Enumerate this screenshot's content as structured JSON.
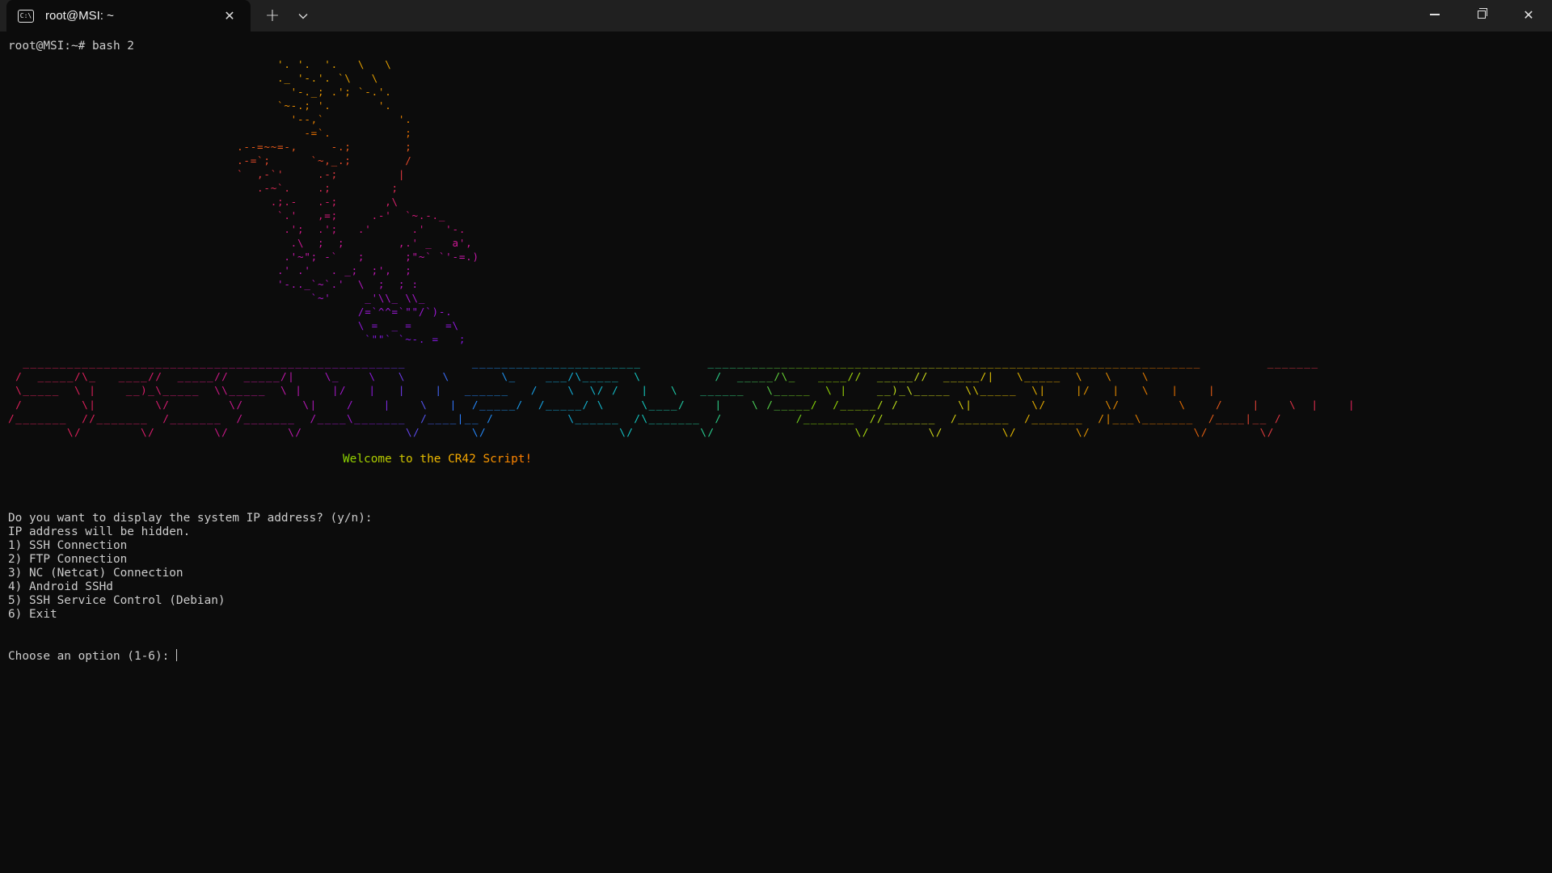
{
  "window": {
    "tab_title": "root@MSI: ~",
    "tab_icon_text": "C:\\",
    "close_tab_glyph": "✕",
    "new_tab_glyph": "+",
    "dropdown_glyph": "⌄",
    "close_window_glyph": "✕"
  },
  "terminal": {
    "command_line": "root@MSI:~# bash 2",
    "art_lines": [
      {
        "text": "                                        '. '.  '.   \\   \\",
        "color": "#e6a100"
      },
      {
        "text": "                                        ._ '-.'. `\\   \\",
        "color": "#e6a100"
      },
      {
        "text": "                                          '-._; .'; `-.'.",
        "color": "#e69400"
      },
      {
        "text": "                                        `~-.; '.       '.",
        "color": "#e68a00"
      },
      {
        "text": "                                          '--,`           '.",
        "color": "#e68000"
      },
      {
        "text": "                                            -=`.           ;",
        "color": "#e66f00"
      },
      {
        "text": "                                  .--=~~=-,     -.;        ;",
        "color": "#e65a1a"
      },
      {
        "text": "                                  .-=`;      `~,_.;        /",
        "color": "#e64a2a"
      },
      {
        "text": "                                  `  ,-`'     .-;         |",
        "color": "#e03a40"
      },
      {
        "text": "                                     .-~`.    .;         ;",
        "color": "#dc2b55"
      },
      {
        "text": "                                       .;.-   .-;       ,\\",
        "color": "#d8206a"
      },
      {
        "text": "                                        `.'   ,=;     .-'  `~.-._",
        "color": "#d41a7a"
      },
      {
        "text": "                                         .';  .';   .'      .'   '-.",
        "color": "#d01888"
      },
      {
        "text": "                                          .\\  ;  ;        ,.' _   a',",
        "color": "#cc1895"
      },
      {
        "text": "                                         .'~\"; -`   ;      ;\"~` `'-=.)",
        "color": "#c418a8"
      },
      {
        "text": "                                        .' .'   . _;  ;',  ;",
        "color": "#be18b4"
      },
      {
        "text": "                                        '-.._`~`.'  \\  ;  ; :",
        "color": "#b418c0"
      },
      {
        "text": "                                             `~'     _'\\\\_ \\\\_",
        "color": "#a818cc"
      },
      {
        "text": "                                                    /=`^^=`\"\"/`)-.",
        "color": "#9c18d6"
      },
      {
        "text": "                                                    \\ =  _ =     =\\",
        "color": "#9018dc"
      },
      {
        "text": "                                                     `\"\"` `~-. =   ;",
        "color": "#8418e0"
      }
    ],
    "banner_lines": [
      {
        "text": "  ____________________________________________________         _______________________         ___________________________________________________________________         _______",
        "colors": [
          "#e0205c",
          "#2a7fff",
          "#c8e020"
        ]
      },
      {
        "text": " /  _____/\\_   ____//  _____//  _____/|    \\_    \\   \\     \\       \\_    ___/\\_____  \\          /  _____/\\_   ____//  _____//  _____/|   \\_____  \\   \\    \\",
        "colors": []
      },
      {
        "text": " \\_____  \\ |    __)_\\_____  \\\\_____  \\ |    |/   |   |    |   ______   /    \\  \\/ /   |   \\   ______   \\_____  \\ |    __)_\\_____  \\\\_____  \\|    |/   |   \\   |    |",
        "colors": []
      },
      {
        "text": " /        \\|        \\/        \\/        \\|    /    |    \\   |  /_____/  /_____/ \\     \\____/    |    \\ /_____/  /_____/ /        \\|        \\/        \\/        \\    /    |    \\  |    |",
        "colors": []
      },
      {
        "text": "/_______  //_______  /_______  /_______  /____\\_______  /____|__ /          \\______  /\\_______  /          /_______  //_______  /_______  /_______  /|___\\_______  /____|__ /",
        "colors": []
      },
      {
        "text": "        \\/        \\/        \\/        \\/              \\/       \\/                  \\/         \\/                   \\/        \\/        \\/        \\/              \\/       \\/",
        "colors": []
      }
    ],
    "welcome_text": "Welcome to the CR42 Script!",
    "welcome_colors": [
      "#8cd400",
      "#f2b900",
      "#ff7a00"
    ],
    "output_lines": [
      "Do you want to display the system IP address? (y/n):",
      "IP address will be hidden.",
      "1) SSH Connection",
      "2) FTP Connection",
      "3) NC (Netcat) Connection",
      "4) Android SSHd",
      "5) SSH Service Control (Debian)",
      "6) Exit"
    ],
    "prompt": "Choose an option (1-6): "
  }
}
